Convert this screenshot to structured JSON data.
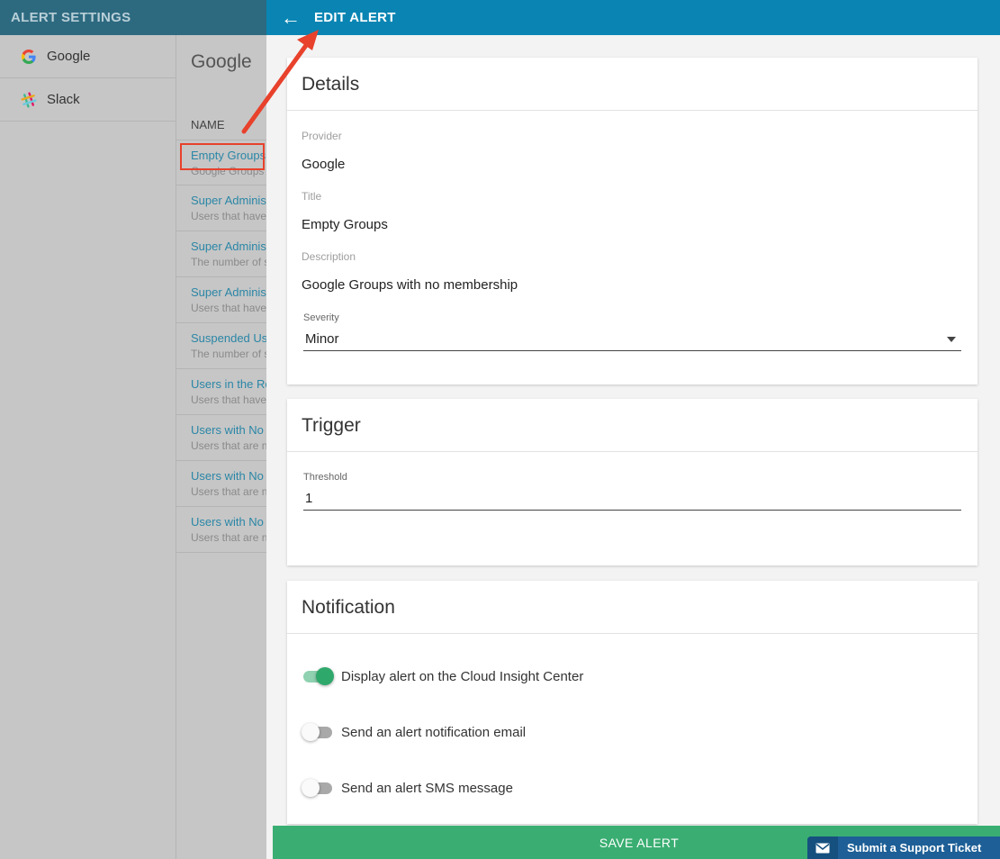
{
  "left_panel": {
    "header_title": "ALERT SETTINGS",
    "providers": [
      {
        "label": "Google",
        "icon": "google-icon"
      },
      {
        "label": "Slack",
        "icon": "slack-icon"
      }
    ]
  },
  "alert_list": {
    "title": "Google",
    "column_header": "NAME",
    "rows": [
      {
        "title": "Empty Groups",
        "desc": "Google Groups with no membership"
      },
      {
        "title": "Super Administrators",
        "desc": "Users that have super admin"
      },
      {
        "title": "Super Administrators",
        "desc": "The number of super admins"
      },
      {
        "title": "Super Administrators",
        "desc": "Users that have super admin"
      },
      {
        "title": "Suspended Users",
        "desc": "The number of suspended users"
      },
      {
        "title": "Users in the Root",
        "desc": "Users that have no org unit"
      },
      {
        "title": "Users with No",
        "desc": "Users that are not"
      },
      {
        "title": "Users with No",
        "desc": "Users that are not"
      },
      {
        "title": "Users with No",
        "desc": "Users that are not"
      }
    ]
  },
  "edit_panel": {
    "header_title": "EDIT ALERT",
    "back_icon": "arrow-left-icon",
    "details": {
      "heading": "Details",
      "provider_label": "Provider",
      "provider_value": "Google",
      "title_label": "Title",
      "title_value": "Empty Groups",
      "description_label": "Description",
      "description_value": "Google Groups with no membership",
      "severity_label": "Severity",
      "severity_value": "Minor"
    },
    "trigger": {
      "heading": "Trigger",
      "threshold_label": "Threshold",
      "threshold_value": "1"
    },
    "notification": {
      "heading": "Notification",
      "options": [
        {
          "label": "Display alert on the Cloud Insight Center",
          "enabled": true
        },
        {
          "label": "Send an alert notification email",
          "enabled": false
        },
        {
          "label": "Send an alert SMS message",
          "enabled": false
        }
      ]
    },
    "save_label": "SAVE ALERT"
  },
  "support": {
    "label": "Submit a Support Ticket",
    "icon": "mail-icon"
  },
  "colors": {
    "header_blue": "#0a85b3",
    "save_green": "#3aae72",
    "annotation_red": "#e8412c",
    "link_blue": "#2a86a6"
  }
}
